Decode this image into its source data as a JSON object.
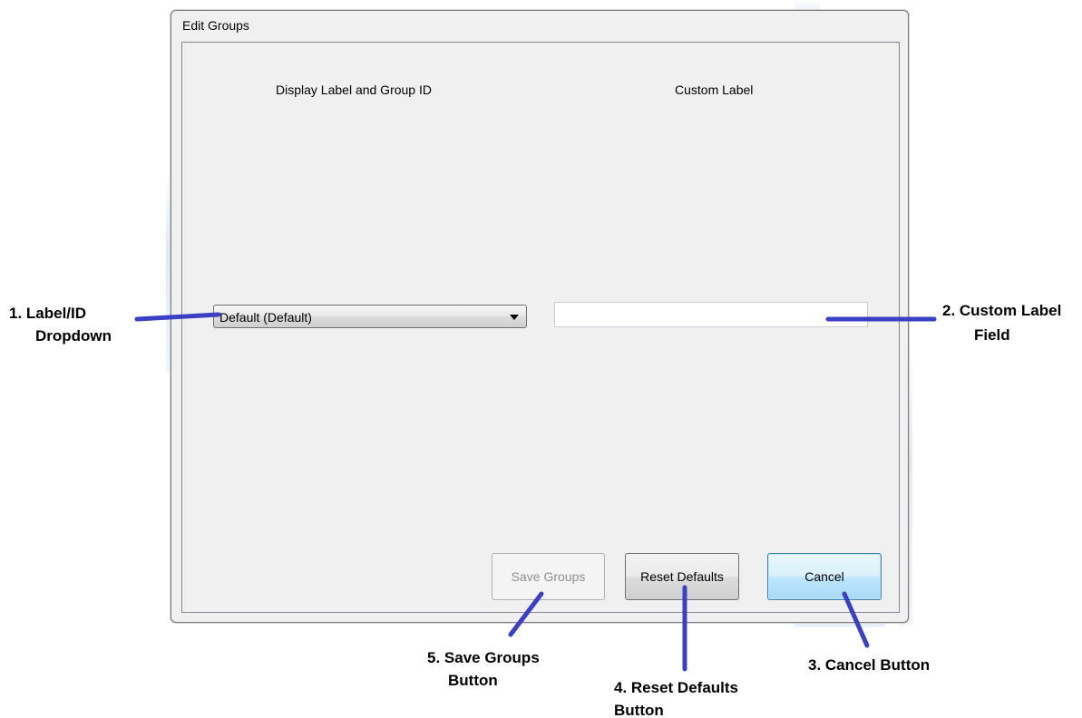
{
  "window": {
    "title": "Edit Groups"
  },
  "columns": {
    "left_header": "Display Label and Group ID",
    "right_header": "Custom Label"
  },
  "dropdown": {
    "selected": "Default (Default)",
    "icon": "chevron-down-icon"
  },
  "custom_label_field": {
    "value": "",
    "placeholder": ""
  },
  "buttons": {
    "save_groups": "Save Groups",
    "save_groups_enabled": false,
    "reset_defaults": "Reset Defaults",
    "cancel": "Cancel"
  },
  "annotations": {
    "label_id_dropdown_1": "1. Label/ID",
    "label_id_dropdown_2": "Dropdown",
    "custom_label_field_1": "2. Custom Label",
    "custom_label_field_2": "Field",
    "cancel_button": "3. Cancel Button",
    "reset_defaults_1": "4. Reset Defaults",
    "reset_defaults_2": "Button",
    "save_groups_1": "5. Save Groups",
    "save_groups_2": "Button",
    "line_color": "#3b3fc4"
  }
}
